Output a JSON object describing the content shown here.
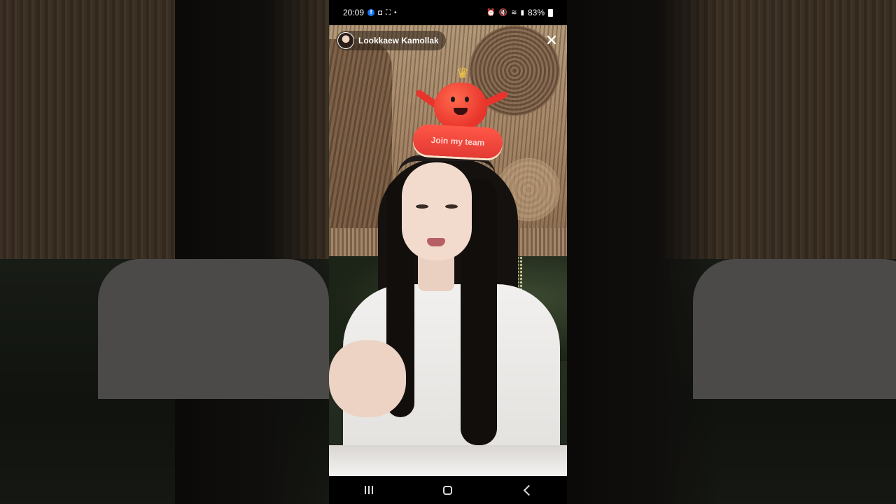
{
  "status_bar": {
    "time": "20:09",
    "left_icons": [
      "facebook-icon",
      "camera-icon",
      "screenshot-icon",
      "dot-icon"
    ],
    "right_icons": [
      "alarm-icon",
      "mute-icon",
      "wifi-icon",
      "signal-icon"
    ],
    "battery": "83%"
  },
  "live": {
    "profile_name": "Lookkaew Kamollak",
    "filter_text": "Join my team"
  },
  "nav": {
    "buttons": [
      "recents-icon",
      "home-icon",
      "back-icon"
    ]
  }
}
